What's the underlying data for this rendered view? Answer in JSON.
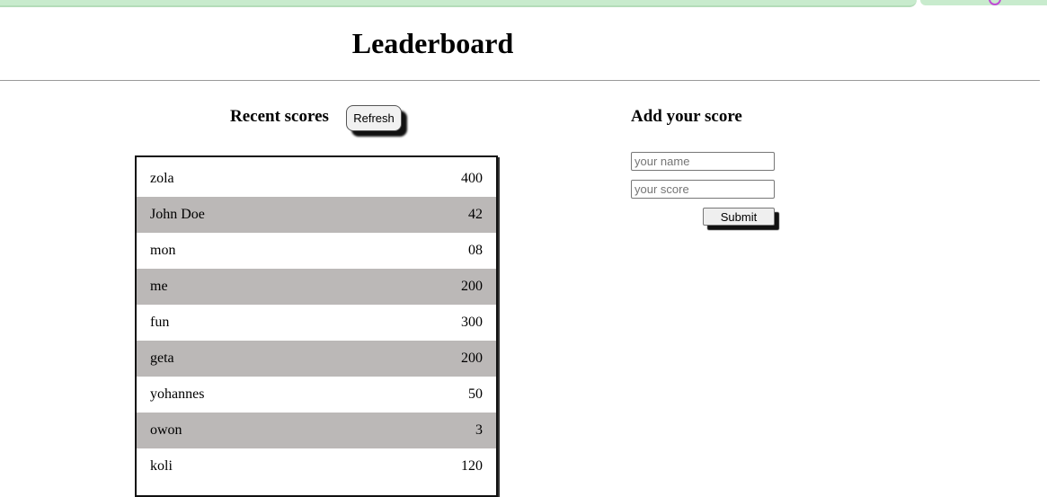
{
  "header": {
    "title": "Leaderboard"
  },
  "recent": {
    "heading": "Recent scores",
    "refresh_label": "Refresh",
    "scores": [
      {
        "name": "zola",
        "score": "400"
      },
      {
        "name": "John Doe",
        "score": "42"
      },
      {
        "name": "mon",
        "score": "08"
      },
      {
        "name": "me",
        "score": "200"
      },
      {
        "name": "fun",
        "score": "300"
      },
      {
        "name": "geta",
        "score": "200"
      },
      {
        "name": "yohannes",
        "score": "50"
      },
      {
        "name": "owon",
        "score": "3"
      },
      {
        "name": "koli",
        "score": "120"
      }
    ]
  },
  "add": {
    "heading": "Add your score",
    "name_placeholder": "your name",
    "score_placeholder": "your score",
    "submit_label": "Submit"
  },
  "colors": {
    "row_alt": "#bbb8b7",
    "browser_strip": "#c8ebcd"
  }
}
